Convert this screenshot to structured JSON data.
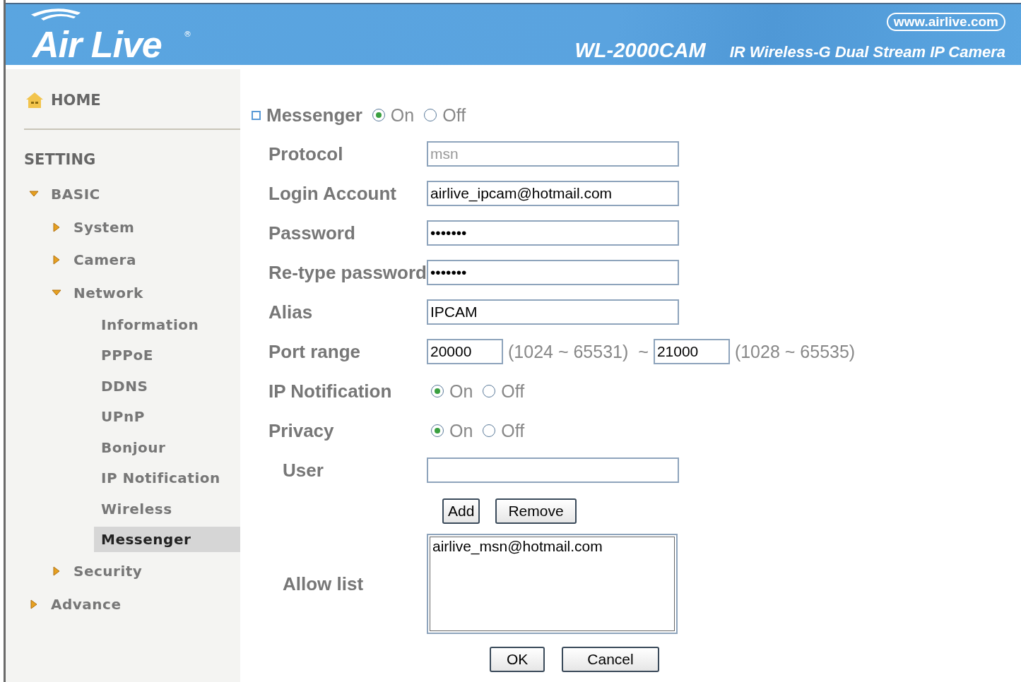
{
  "header": {
    "logo": "Air Live",
    "registered": "®",
    "website": "www.airlive.com",
    "model": "WL-2000CAM",
    "product": "IR Wireless-G Dual Stream IP Camera"
  },
  "sidebar": {
    "home": "HOME",
    "section": "SETTING",
    "items": [
      {
        "label": "BASIC",
        "kind": "folder",
        "expanded": true,
        "selected": false,
        "children": [
          {
            "label": "System",
            "kind": "folder",
            "expanded": false,
            "selected": false
          },
          {
            "label": "Camera",
            "kind": "folder",
            "expanded": false,
            "selected": false
          },
          {
            "label": "Network",
            "kind": "folder",
            "expanded": true,
            "selected": false,
            "children": [
              {
                "label": "Information",
                "kind": "leaf",
                "selected": false
              },
              {
                "label": "PPPoE",
                "kind": "leaf",
                "selected": false
              },
              {
                "label": "DDNS",
                "kind": "leaf",
                "selected": false
              },
              {
                "label": "UPnP",
                "kind": "leaf",
                "selected": false
              },
              {
                "label": "Bonjour",
                "kind": "leaf",
                "selected": false
              },
              {
                "label": "IP Notification",
                "kind": "leaf",
                "selected": false
              },
              {
                "label": "Wireless",
                "kind": "leaf",
                "selected": false
              },
              {
                "label": "Messenger",
                "kind": "leaf",
                "selected": true
              }
            ]
          },
          {
            "label": "Security",
            "kind": "folder",
            "expanded": false,
            "selected": false
          }
        ]
      },
      {
        "label": "Advance",
        "kind": "folder",
        "expanded": false,
        "selected": false
      }
    ]
  },
  "form": {
    "title": "Messenger",
    "title_options": [
      {
        "label": "On",
        "selected": true
      },
      {
        "label": "Off",
        "selected": false
      }
    ],
    "rows": [
      {
        "kind": "text",
        "label": "Protocol",
        "value": "msn",
        "disabled": true
      },
      {
        "kind": "text",
        "label": "Login Account",
        "value": "airlive_ipcam@hotmail.com",
        "disabled": false
      },
      {
        "kind": "text",
        "label": "Password",
        "value": "•••••••",
        "disabled": false
      },
      {
        "kind": "text",
        "label": "Re-type password",
        "value": "•••••••",
        "disabled": false
      },
      {
        "kind": "text",
        "label": "Alias",
        "value": "IPCAM",
        "disabled": false
      },
      {
        "kind": "port",
        "label": "Port range",
        "from": "20000",
        "from_range": "(1024 ~ 65531)",
        "separator": "~",
        "to": "21000",
        "to_range": "(1028 ~ 65535)"
      },
      {
        "kind": "radio",
        "label": "IP Notification",
        "options": [
          {
            "label": "On",
            "selected": true
          },
          {
            "label": "Off",
            "selected": false
          }
        ]
      },
      {
        "kind": "radio",
        "label": "Privacy",
        "options": [
          {
            "label": "On",
            "selected": true
          },
          {
            "label": "Off",
            "selected": false
          }
        ]
      },
      {
        "kind": "user",
        "label": "User"
      },
      {
        "kind": "buttons",
        "buttons": [
          "Add",
          "Remove"
        ]
      },
      {
        "kind": "list",
        "label": "Allow list",
        "items": [
          "airlive_msn@hotmail.com"
        ]
      }
    ],
    "buttons": [
      "OK",
      "Cancel"
    ]
  }
}
